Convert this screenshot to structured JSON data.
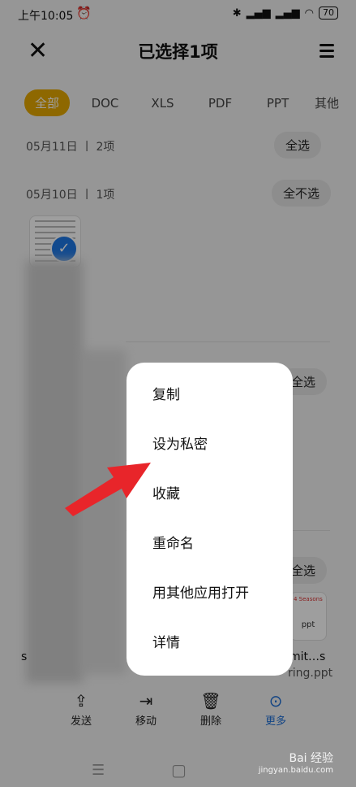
{
  "status_bar": {
    "time": "上午10:05",
    "battery": "70"
  },
  "header": {
    "title": "已选择1项"
  },
  "tabs": [
    {
      "label": "全部",
      "active": true
    },
    {
      "label": "DOC"
    },
    {
      "label": "XLS"
    },
    {
      "label": "PDF"
    },
    {
      "label": "PPT"
    },
    {
      "label": "其他"
    }
  ],
  "groups": [
    {
      "date": "05月11日 丨 2项",
      "action": "全选"
    },
    {
      "date": "05月10日 丨 1项",
      "action": "全不选"
    },
    {
      "action": "全选"
    },
    {
      "action": "全选"
    }
  ],
  "file_fragments": {
    "name_part_1": "mit…s",
    "name_part_2": "ring.ppt",
    "prefix": "s",
    "thumb_line_1": "4 Seasons",
    "thumb_line_2": "ppt"
  },
  "context_menu": {
    "items": [
      "复制",
      "设为私密",
      "收藏",
      "重命名",
      "用其他应用打开",
      "详情"
    ]
  },
  "bottom_bar": [
    {
      "label": "发送",
      "icon": "share-icon"
    },
    {
      "label": "移动",
      "icon": "move-icon"
    },
    {
      "label": "删除",
      "icon": "trash-icon"
    },
    {
      "label": "更多",
      "icon": "more-icon",
      "active": true
    }
  ],
  "watermark": {
    "brand": "Bai 经验",
    "url": "jingyan.baidu.com"
  },
  "colors": {
    "accent": "#e6a800",
    "active_blue": "#1e6fd6",
    "arrow": "#e8252a"
  }
}
